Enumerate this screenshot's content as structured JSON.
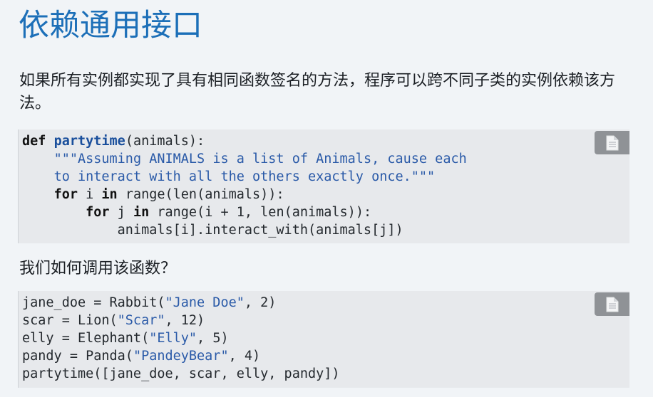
{
  "page": {
    "title": "依赖通用接口",
    "intro": "如果所有实例都实现了具有相同函数签名的方法，程序可以跨不同子类的实例依赖该方法。",
    "question": "我们如何调用该函数？"
  },
  "code_blocks": [
    {
      "copy_icon": "copy-document-icon",
      "lines": [
        [
          {
            "t": "def",
            "c": "kw"
          },
          {
            "t": " "
          },
          {
            "t": "partytime",
            "c": "fn"
          },
          {
            "t": "(animals):"
          }
        ],
        [
          {
            "t": "    "
          },
          {
            "t": "\"\"\"Assuming ANIMALS is a list of Animals, cause each",
            "c": "str"
          }
        ],
        [
          {
            "t": "    "
          },
          {
            "t": "to interact with all the others exactly once.\"\"\"",
            "c": "str"
          }
        ],
        [
          {
            "t": "    "
          },
          {
            "t": "for",
            "c": "kw"
          },
          {
            "t": " i "
          },
          {
            "t": "in",
            "c": "kw"
          },
          {
            "t": " range(len(animals)):"
          }
        ],
        [
          {
            "t": "        "
          },
          {
            "t": "for",
            "c": "kw"
          },
          {
            "t": " j "
          },
          {
            "t": "in",
            "c": "kw"
          },
          {
            "t": " range(i + 1, len(animals)):"
          }
        ],
        [
          {
            "t": "            animals[i].interact_with(animals[j])"
          }
        ]
      ]
    },
    {
      "copy_icon": "copy-document-icon",
      "lines": [
        [
          {
            "t": "jane_doe = Rabbit("
          },
          {
            "t": "\"Jane Doe\"",
            "c": "str"
          },
          {
            "t": ", 2)"
          }
        ],
        [
          {
            "t": "scar = Lion("
          },
          {
            "t": "\"Scar\"",
            "c": "str"
          },
          {
            "t": ", 12)"
          }
        ],
        [
          {
            "t": "elly = Elephant("
          },
          {
            "t": "\"Elly\"",
            "c": "str"
          },
          {
            "t": ", 5)"
          }
        ],
        [
          {
            "t": "pandy = Panda("
          },
          {
            "t": "\"PandeyBear\"",
            "c": "str"
          },
          {
            "t": ", 4)"
          }
        ],
        [
          {
            "t": "partytime([jane_doe, scar, elly, pandy])"
          }
        ]
      ]
    }
  ],
  "colors": {
    "title": "#1c6fb8",
    "background": "#f1f4f7",
    "code_background": "#e7e9ec",
    "string": "#2a5aa8",
    "function_name": "#1a4f9c",
    "copy_button": "#8f9296"
  }
}
